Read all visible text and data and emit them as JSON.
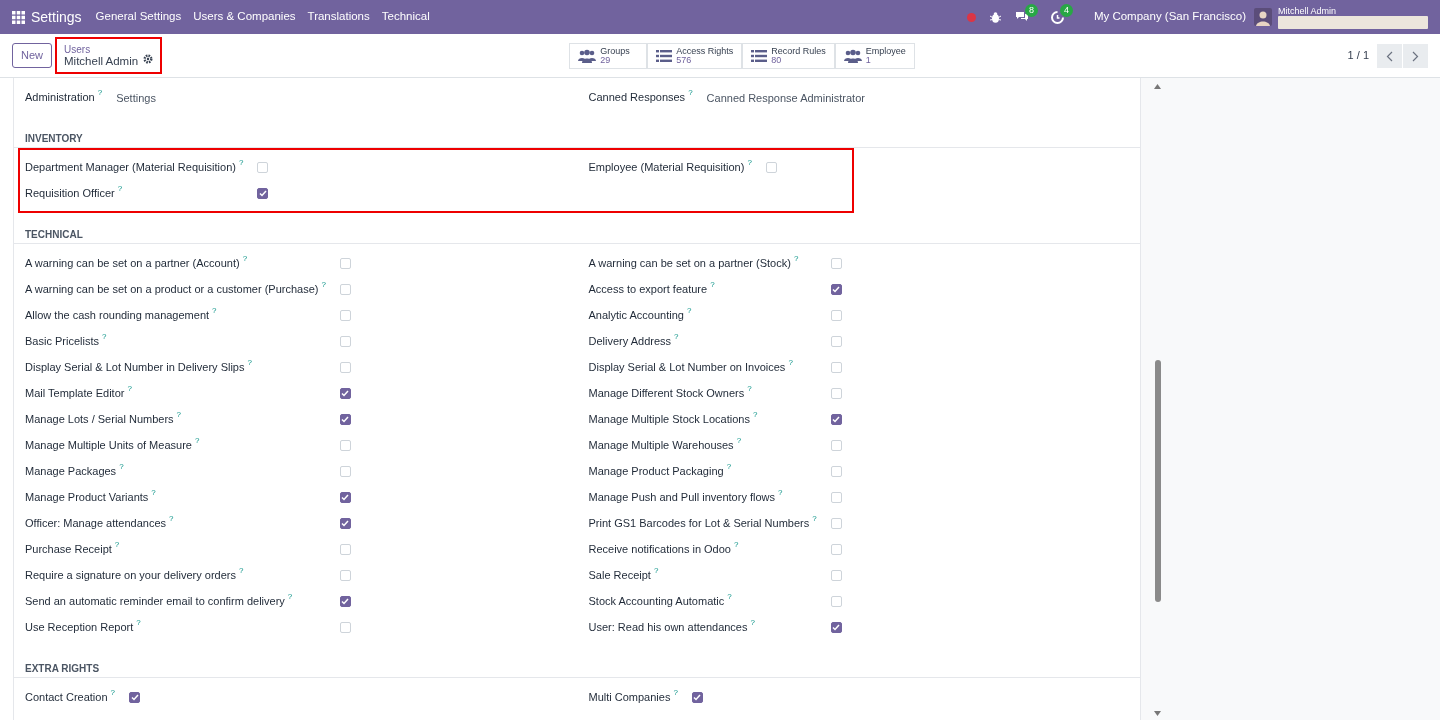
{
  "navbar": {
    "app": "Settings",
    "menus": [
      "General Settings",
      "Users & Companies",
      "Translations",
      "Technical"
    ],
    "messages_count": "8",
    "activities_count": "4",
    "company": "My Company (San Francisco)",
    "user": "Mitchell Admin"
  },
  "control_panel": {
    "new_button": "New",
    "breadcrumb": "Users",
    "record": "Mitchell Admin",
    "breadcrumb_highlighted": true,
    "smart_buttons": [
      {
        "kind": "group",
        "label": "Groups",
        "count": "29"
      },
      {
        "kind": "list",
        "label": "Access Rights",
        "count": "576"
      },
      {
        "kind": "list",
        "label": "Record Rules",
        "count": "80"
      },
      {
        "kind": "group",
        "label": "Employee",
        "count": "1"
      }
    ],
    "pager": "1 / 1"
  },
  "sections": [
    {
      "highlighted": false,
      "left": [
        {
          "kind": "select",
          "label": "Administration",
          "help": "?",
          "value": "Settings"
        }
      ],
      "right": [
        {
          "kind": "select",
          "label": "Canned Responses",
          "help": "?",
          "value": "Canned Response Administrator"
        }
      ]
    },
    {
      "title": "INVENTORY",
      "highlighted": true,
      "left": [
        {
          "kind": "check",
          "label": "Department Manager (Material Requisition)",
          "help": "?",
          "checked": false
        },
        {
          "kind": "check",
          "label": "Requisition Officer",
          "help": "?",
          "checked": true
        }
      ],
      "right": [
        {
          "kind": "check",
          "label": "Employee (Material Requisition)",
          "help": "?",
          "checked": false
        }
      ]
    },
    {
      "title": "TECHNICAL",
      "highlighted": false,
      "left": [
        {
          "kind": "check",
          "label": "A warning can be set on a partner (Account)",
          "help": "?",
          "checked": false
        },
        {
          "kind": "check",
          "label": "A warning can be set on a product or a customer (Purchase)",
          "help": "?",
          "checked": false
        },
        {
          "kind": "check",
          "label": "Allow the cash rounding management",
          "help": "?",
          "checked": false
        },
        {
          "kind": "check",
          "label": "Basic Pricelists",
          "help": "?",
          "checked": false
        },
        {
          "kind": "check",
          "label": "Display Serial & Lot Number in Delivery Slips",
          "help": "?",
          "checked": false
        },
        {
          "kind": "check",
          "label": "Mail Template Editor",
          "help": "?",
          "checked": true
        },
        {
          "kind": "check",
          "label": "Manage Lots / Serial Numbers",
          "help": "?",
          "checked": true
        },
        {
          "kind": "check",
          "label": "Manage Multiple Units of Measure",
          "help": "?",
          "checked": false
        },
        {
          "kind": "check",
          "label": "Manage Packages",
          "help": "?",
          "checked": false
        },
        {
          "kind": "check",
          "label": "Manage Product Variants",
          "help": "?",
          "checked": true
        },
        {
          "kind": "check",
          "label": "Officer: Manage attendances",
          "help": "?",
          "checked": true
        },
        {
          "kind": "check",
          "label": "Purchase Receipt",
          "help": "?",
          "checked": false
        },
        {
          "kind": "check",
          "label": "Require a signature on your delivery orders",
          "help": "?",
          "checked": false
        },
        {
          "kind": "check",
          "label": "Send an automatic reminder email to confirm delivery",
          "help": "?",
          "checked": true
        },
        {
          "kind": "check",
          "label": "Use Reception Report",
          "help": "?",
          "checked": false
        }
      ],
      "right": [
        {
          "kind": "check",
          "label": "A warning can be set on a partner (Stock)",
          "help": "?",
          "checked": false
        },
        {
          "kind": "check",
          "label": "Access to export feature",
          "help": "?",
          "checked": true
        },
        {
          "kind": "check",
          "label": "Analytic Accounting",
          "help": "?",
          "checked": false
        },
        {
          "kind": "check",
          "label": "Delivery Address",
          "help": "?",
          "checked": false
        },
        {
          "kind": "check",
          "label": "Display Serial & Lot Number on Invoices",
          "help": "?",
          "checked": false
        },
        {
          "kind": "check",
          "label": "Manage Different Stock Owners",
          "help": "?",
          "checked": false
        },
        {
          "kind": "check",
          "label": "Manage Multiple Stock Locations",
          "help": "?",
          "checked": true
        },
        {
          "kind": "check",
          "label": "Manage Multiple Warehouses",
          "help": "?",
          "checked": false
        },
        {
          "kind": "check",
          "label": "Manage Product Packaging",
          "help": "?",
          "checked": false
        },
        {
          "kind": "check",
          "label": "Manage Push and Pull inventory flows",
          "help": "?",
          "checked": false
        },
        {
          "kind": "check",
          "label": "Print GS1 Barcodes for Lot & Serial Numbers",
          "help": "?",
          "checked": false
        },
        {
          "kind": "check",
          "label": "Receive notifications in Odoo",
          "help": "?",
          "checked": false
        },
        {
          "kind": "check",
          "label": "Sale Receipt",
          "help": "?",
          "checked": false
        },
        {
          "kind": "check",
          "label": "Stock Accounting Automatic",
          "help": "?",
          "checked": false
        },
        {
          "kind": "check",
          "label": "User: Read his own attendances",
          "help": "?",
          "checked": true
        }
      ]
    },
    {
      "title": "EXTRA RIGHTS",
      "highlighted": false,
      "left": [
        {
          "kind": "check",
          "label": "Contact Creation",
          "help": "?",
          "checked": true
        }
      ],
      "right": [
        {
          "kind": "check",
          "label": "Multi Companies",
          "help": "?",
          "checked": true
        }
      ]
    }
  ]
}
